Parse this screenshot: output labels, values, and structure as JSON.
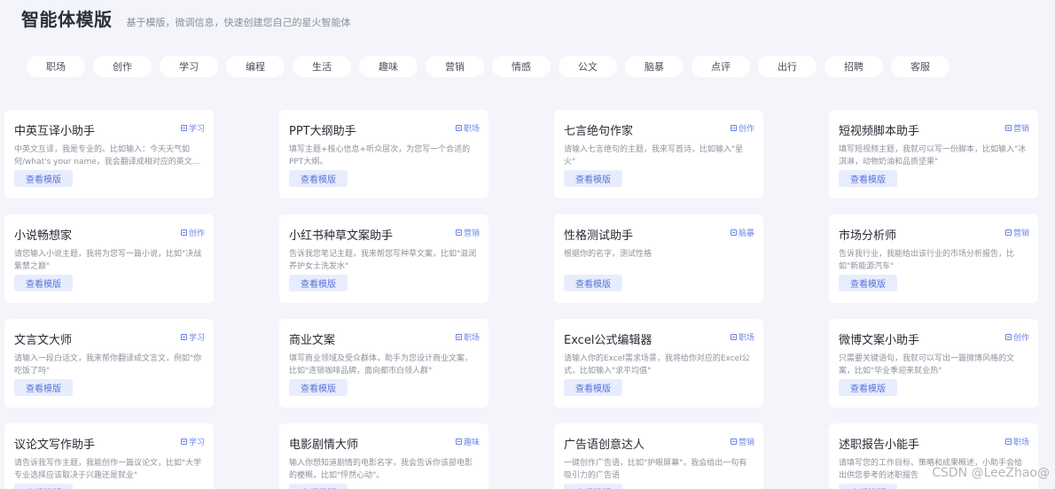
{
  "header": {
    "title": "智能体模版",
    "subtitle": "基于模版，微调信息，快速创建您自己的星火智能体"
  },
  "tabs": [
    "职场",
    "创作",
    "学习",
    "编程",
    "生活",
    "趣味",
    "营销",
    "情感",
    "公文",
    "脑暴",
    "点评",
    "出行",
    "招聘",
    "客服"
  ],
  "card_button_label": "查看模版",
  "cards": [
    {
      "title": "中英互译小助手",
      "tag": "学习",
      "desc": "中英文互译，我是专业的。比如输入：今天天气如何/what's your name，我会翻译成相对应的英文..."
    },
    {
      "title": "PPT大纲助手",
      "tag": "职场",
      "desc": "填写主题+核心信息+听众层次，为您写一个合适的PPT大纲。"
    },
    {
      "title": "七言绝句作家",
      "tag": "创作",
      "desc": "请输入七言绝句的主题，我来写首诗，比如输入\"星火\""
    },
    {
      "title": "短视频脚本助手",
      "tag": "营销",
      "desc": "填写短视频主题，我就可以写一份脚本，比如输入\"冰淇淋，动物奶油和品质坚果\""
    },
    {
      "title": "小说畅想家",
      "tag": "创作",
      "desc": "请您输入小说主题，我将为您写一篇小说，比如\"决战紫禁之巅\""
    },
    {
      "title": "小红书种草文案助手",
      "tag": "营销",
      "desc": "告诉我您笔记主题，我来帮您写种草文案，比如\"滋润养护女士洗发水\""
    },
    {
      "title": "性格测试助手",
      "tag": "脑暴",
      "desc": "根据你的名字，测试性格"
    },
    {
      "title": "市场分析师",
      "tag": "营销",
      "desc": "告诉我行业，我能给出该行业的市场分析报告，比如\"新能源汽车\""
    },
    {
      "title": "文言文大师",
      "tag": "学习",
      "desc": "请输入一段白话文，我来帮你翻译成文言文，例如\"你吃饭了吗\""
    },
    {
      "title": "商业文案",
      "tag": "职场",
      "desc": "填写商业领域及受众群体，助手为您设计商业文案，比如\"连锁咖啡品牌，面向都市白领人群\""
    },
    {
      "title": "Excel公式编辑器",
      "tag": "职场",
      "desc": "请输入你的Excel需求场景，我将给你对应的Excel公式，比如输入\"求平均值\""
    },
    {
      "title": "微博文案小助手",
      "tag": "创作",
      "desc": "只需要关键语句，我就可以写出一篇微博风格的文案，比如\"毕业季迎来就业热\""
    },
    {
      "title": "议论文写作助手",
      "tag": "学习",
      "desc": "请告诉我写作主题，我能创作一篇议论文，比如\"大学专业选择应该取决于兴趣还是就业\""
    },
    {
      "title": "电影剧情大师",
      "tag": "趣味",
      "desc": "输入你想知道剧情的电影名字，我会告诉你该部电影的梗概，比如\"怦然心动\"。"
    },
    {
      "title": "广告语创意达人",
      "tag": "营销",
      "desc": "一键创作广告语，比如\"护眼屏幕\"，我会给出一句有吸引力的广告语"
    },
    {
      "title": "述职报告小能手",
      "tag": "职场",
      "desc": "请填写您的工作目标、策略和成果概述，小助手会给出供您参考的述职报告"
    }
  ],
  "watermark": "CSDN @LeeZhao@"
}
